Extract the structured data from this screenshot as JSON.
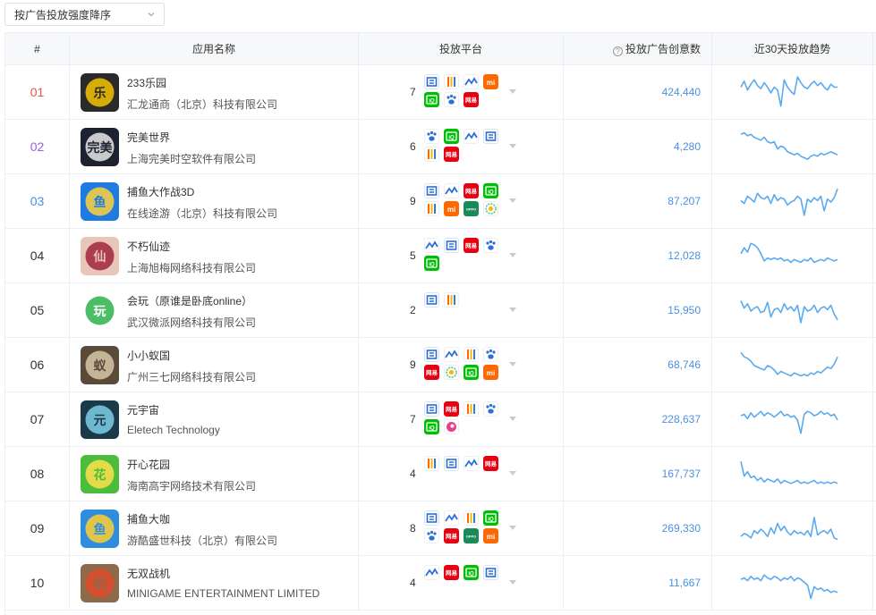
{
  "sort": {
    "label": "按广告投放强度降序"
  },
  "header": {
    "rank": "#",
    "app": "应用名称",
    "platform": "投放平台",
    "count": "投放广告创意数",
    "trend": "近30天投放趋势",
    "help": "?"
  },
  "colors": {
    "rank1": "#e8534b",
    "rank2": "#9b5de5",
    "rank3": "#4a90e2",
    "count": "#4a90e2",
    "line": "#5aaaf0"
  },
  "rows": [
    {
      "rank": "01",
      "name": "233乐园",
      "company": "汇龙通商（北京）科技有限公司",
      "platform_count": "7",
      "platforms": [
        "toutiao",
        "kuaishou",
        "wps",
        "xiaomi",
        "iqiyi",
        "baidu",
        "wangyi"
      ],
      "count": "424,440",
      "icon": "le-icon",
      "icon_text": "乐",
      "trend": [
        30,
        38,
        26,
        34,
        40,
        32,
        28,
        36,
        30,
        22,
        30,
        26,
        4,
        40,
        30,
        24,
        20,
        44,
        36,
        30,
        28,
        34,
        38,
        32,
        36,
        30,
        26,
        34,
        30,
        30
      ]
    },
    {
      "rank": "02",
      "name": "完美世界",
      "company": "上海完美时空软件有限公司",
      "platform_count": "6",
      "platforms": [
        "baidu",
        "iqiyi",
        "wps",
        "toutiao",
        "kuaishou",
        "wangyi"
      ],
      "count": "4,280",
      "icon": "wanmei-icon",
      "icon_text": "完美",
      "trend": [
        40,
        42,
        38,
        40,
        36,
        34,
        32,
        36,
        30,
        28,
        30,
        20,
        24,
        22,
        16,
        14,
        12,
        14,
        10,
        8,
        6,
        10,
        12,
        10,
        14,
        12,
        14,
        16,
        14,
        12
      ]
    },
    {
      "rank": "03",
      "name": "捕鱼大作战3D",
      "company": "在线途游（北京）科技有限公司",
      "platform_count": "9",
      "platforms": [
        "toutiao",
        "wps",
        "wangyi",
        "iqiyi",
        "kuaishou",
        "xiaomi",
        "oppo",
        "jinri"
      ],
      "count": "87,207",
      "icon": "fish-icon",
      "icon_text": "鱼",
      "trend": [
        24,
        20,
        30,
        26,
        22,
        34,
        28,
        26,
        30,
        20,
        32,
        24,
        28,
        26,
        18,
        22,
        24,
        30,
        26,
        4,
        26,
        22,
        28,
        24,
        30,
        10,
        26,
        22,
        28,
        40
      ]
    },
    {
      "rank": "04",
      "name": "不朽仙迹",
      "company": "上海旭梅网络科技有限公司",
      "platform_count": "5",
      "platforms": [
        "wps",
        "toutiao",
        "wangyi",
        "baidu",
        "iqiyi"
      ],
      "count": "12,028",
      "icon": "xian-icon",
      "icon_text": "仙",
      "trend": [
        26,
        34,
        28,
        40,
        38,
        34,
        26,
        16,
        20,
        18,
        20,
        18,
        20,
        16,
        18,
        14,
        18,
        16,
        14,
        18,
        16,
        20,
        14,
        16,
        18,
        16,
        20,
        18,
        16,
        18
      ]
    },
    {
      "rank": "05",
      "name": "会玩（原谁是卧底online）",
      "company": "武汉微派网络科技有限公司",
      "platform_count": "2",
      "platforms": [
        "toutiao",
        "kuaishou"
      ],
      "count": "15,950",
      "icon": "huiwan-icon",
      "icon_text": "玩",
      "trend": [
        36,
        26,
        32,
        22,
        26,
        28,
        20,
        22,
        34,
        14,
        24,
        26,
        20,
        32,
        24,
        28,
        22,
        30,
        6,
        28,
        22,
        24,
        30,
        20,
        26,
        28,
        24,
        30,
        18,
        10
      ]
    },
    {
      "rank": "06",
      "name": "小小蚁国",
      "company": "广州三七网络科技有限公司",
      "platform_count": "9",
      "platforms": [
        "toutiao",
        "wps",
        "kuaishou",
        "baidu",
        "wangyi",
        "jinri",
        "iqiyi",
        "xiaomi"
      ],
      "count": "68,746",
      "icon": "ant-icon",
      "icon_text": "蚁",
      "trend": [
        40,
        34,
        32,
        28,
        22,
        20,
        18,
        16,
        22,
        20,
        16,
        10,
        14,
        12,
        10,
        8,
        12,
        10,
        8,
        10,
        8,
        12,
        10,
        14,
        12,
        16,
        20,
        18,
        24,
        34
      ]
    },
    {
      "rank": "07",
      "name": "元宇宙",
      "company": "Eletech Technology",
      "platform_count": "7",
      "platforms": [
        "toutiao",
        "wangyi",
        "kuaishou",
        "baidu",
        "iqiyi",
        "pink"
      ],
      "count": "228,637",
      "icon": "yuan-icon",
      "icon_text": "元",
      "trend": [
        28,
        30,
        24,
        32,
        26,
        30,
        34,
        28,
        32,
        30,
        26,
        30,
        34,
        28,
        30,
        26,
        28,
        22,
        4,
        30,
        34,
        32,
        28,
        30,
        34,
        30,
        32,
        28,
        30,
        22
      ]
    },
    {
      "rank": "08",
      "name": "开心花园",
      "company": "海南高宇网络技术有限公司",
      "platform_count": "4",
      "platforms": [
        "kuaishou",
        "toutiao",
        "wps",
        "wangyi"
      ],
      "count": "167,737",
      "icon": "garden-icon",
      "icon_text": "花",
      "trend": [
        40,
        20,
        26,
        18,
        20,
        14,
        18,
        12,
        16,
        14,
        12,
        16,
        10,
        14,
        12,
        10,
        12,
        14,
        10,
        12,
        10,
        12,
        14,
        10,
        12,
        10,
        12,
        10,
        12,
        10
      ]
    },
    {
      "rank": "09",
      "name": "捕鱼大咖",
      "company": "游酷盛世科技（北京）有限公司",
      "platform_count": "8",
      "platforms": [
        "toutiao",
        "wps",
        "kuaishou",
        "iqiyi",
        "baidu",
        "wangyi",
        "oppo",
        "xiaomi"
      ],
      "count": "269,330",
      "icon": "dakafish-icon",
      "icon_text": "鱼",
      "trend": [
        12,
        16,
        14,
        10,
        20,
        16,
        22,
        18,
        12,
        24,
        16,
        30,
        20,
        26,
        18,
        14,
        20,
        16,
        18,
        14,
        20,
        12,
        38,
        14,
        18,
        20,
        16,
        22,
        10,
        8
      ]
    },
    {
      "rank": "10",
      "name": "无双战机",
      "company": "MINIGAME ENTERTAINMENT LIMITED",
      "platform_count": "4",
      "platforms": [
        "wps",
        "wangyi",
        "iqiyi",
        "toutiao"
      ],
      "count": "11,667",
      "icon": "jet-icon",
      "icon_text": "机",
      "trend": [
        28,
        30,
        26,
        32,
        28,
        30,
        26,
        34,
        30,
        28,
        32,
        30,
        26,
        30,
        28,
        32,
        26,
        30,
        28,
        24,
        20,
        2,
        18,
        14,
        16,
        12,
        14,
        10,
        12,
        10
      ]
    }
  ]
}
